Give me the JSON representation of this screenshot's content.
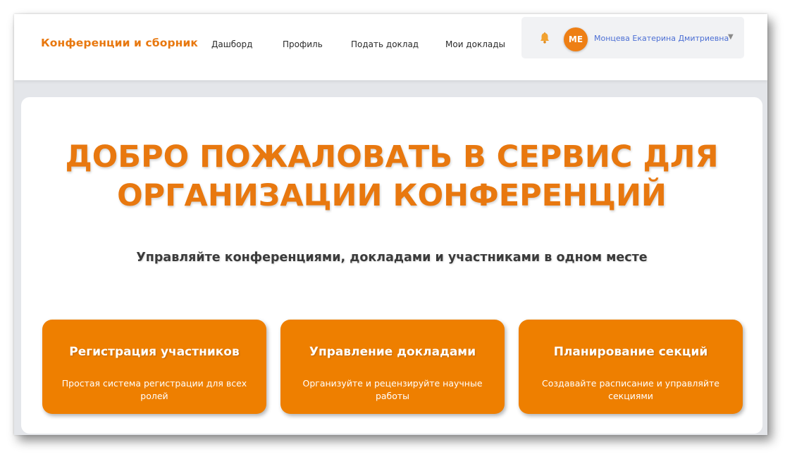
{
  "navbar": {
    "brand": "Конференции и сборник",
    "links": [
      {
        "label": "Дашборд"
      },
      {
        "label": "Профиль"
      },
      {
        "label": "Подать доклад"
      },
      {
        "label": "Мои доклады"
      }
    ],
    "user": {
      "initials": "МЕ",
      "name": "Монцева Екатерина Дмитриевна",
      "caret": "▼"
    }
  },
  "hero": {
    "title_line1": "ДОБРО ПОЖАЛОВАТЬ В СЕРВИС ДЛЯ",
    "title_line2": "ОРГАНИЗАЦИИ КОНФЕРЕНЦИЙ",
    "subtitle": "Управляйте конференциями, докладами и участниками в одном месте"
  },
  "features": [
    {
      "title": "Регистрация участников",
      "description": "Простая система регистрации для всех ролей"
    },
    {
      "title": "Управление докладами",
      "description": "Организуйте и рецензируйте научные работы"
    },
    {
      "title": "Планирование секций",
      "description": "Создавайте расписание и управляйте секциями"
    }
  ],
  "colors": {
    "accent": "#e8780f",
    "card_orange": "#ee7f00",
    "user_name": "#4c6fd4",
    "bell": "#f2a230"
  },
  "icons": {
    "bell": "bell-icon",
    "caret": "chevron-down-icon"
  }
}
